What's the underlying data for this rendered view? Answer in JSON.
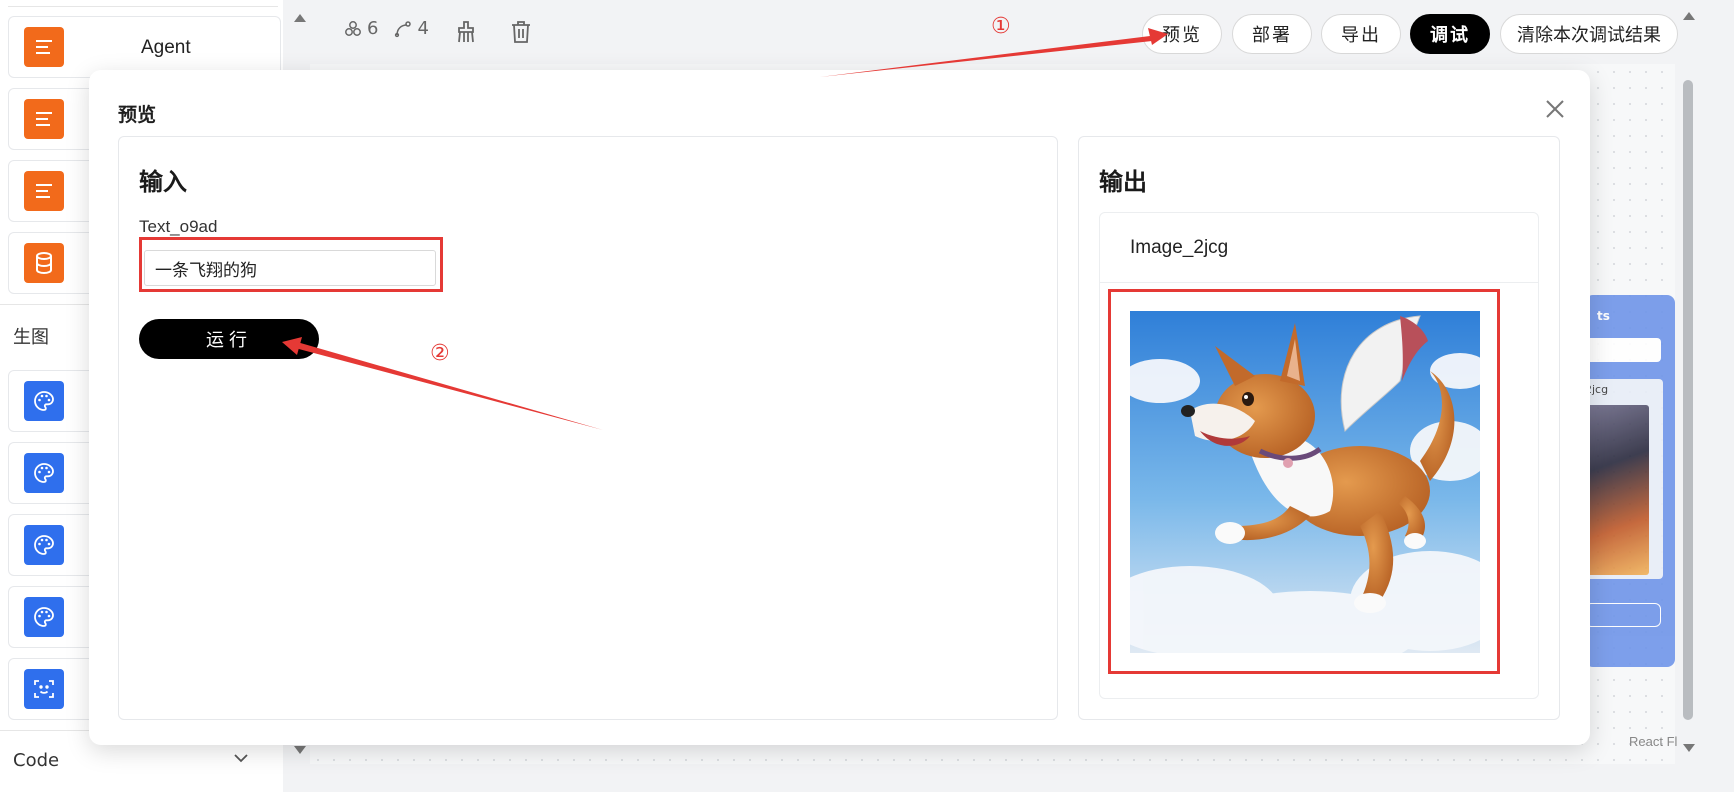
{
  "sidebar": {
    "items": [
      {
        "label": "Agent",
        "icon": "text-lines-icon",
        "color": "#f26a1b"
      },
      {
        "label": "",
        "icon": "text-lines-icon",
        "color": "#f26a1b"
      },
      {
        "label": "",
        "icon": "text-lines-icon",
        "color": "#f26a1b"
      },
      {
        "label": "",
        "icon": "database-icon",
        "color": "#f26a1b"
      }
    ],
    "group_image": "生图",
    "image_items": [
      {
        "icon": "palette-icon",
        "color": "#2f6fed"
      },
      {
        "icon": "palette-icon",
        "color": "#2f6fed"
      },
      {
        "icon": "palette-icon",
        "color": "#2f6fed"
      },
      {
        "icon": "palette-icon",
        "color": "#2f6fed"
      },
      {
        "icon": "face-scan-icon",
        "color": "#2f6fed"
      }
    ],
    "group_code": "Code"
  },
  "toolbar": {
    "node_count": "6",
    "edge_count": "4",
    "preview_label": "预览",
    "deploy_label": "部署",
    "export_label": "导出",
    "debug_label": "调试",
    "clear_label": "清除本次调试结果"
  },
  "annotations": {
    "step1": "①",
    "step2": "②",
    "color": "#e53935"
  },
  "modal": {
    "title": "预览",
    "input_panel": {
      "heading": "输入",
      "field_label": "Text_o9ad",
      "field_value": "一条飞翔的狗",
      "run_label": "运行"
    },
    "output_panel": {
      "heading": "输出",
      "item_label": "Image_2jcg"
    }
  },
  "canvas": {
    "watermark": "React Fl"
  }
}
